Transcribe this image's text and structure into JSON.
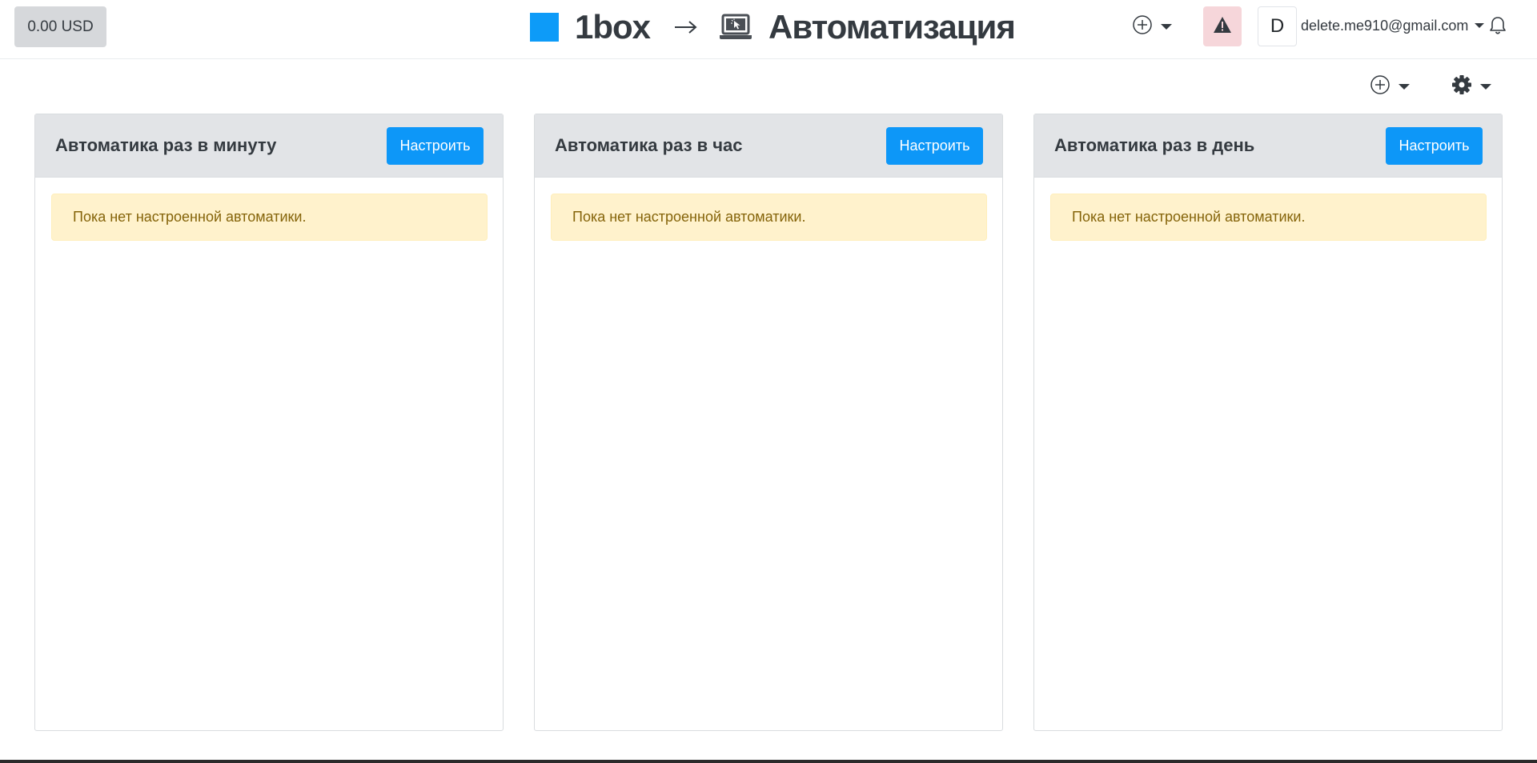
{
  "header": {
    "balance": "0.00 USD",
    "brand_name": "1box",
    "page_title": "Автоматизация",
    "avatar_letter": "D",
    "user_email": "delete.me910@gmail.com",
    "brand_color": "#0d9bf8",
    "alert_color": "#f6d6da"
  },
  "icons": {
    "add": "plus-circle",
    "settings": "gear",
    "alert": "warning-triangle",
    "notifications": "bell",
    "page": "laptop-cursor"
  },
  "cards": [
    {
      "title": "Автоматика раз в минуту",
      "button": "Настроить",
      "empty_message": "Пока нет настроенной автоматики."
    },
    {
      "title": "Автоматика раз в час",
      "button": "Настроить",
      "empty_message": "Пока нет настроенной автоматики."
    },
    {
      "title": "Автоматика раз в день",
      "button": "Настроить",
      "empty_message": "Пока нет настроенной автоматики."
    }
  ],
  "colors": {
    "accent": "#0d97f8",
    "warning_bg": "#fff2cc",
    "warning_text": "#85640a"
  }
}
